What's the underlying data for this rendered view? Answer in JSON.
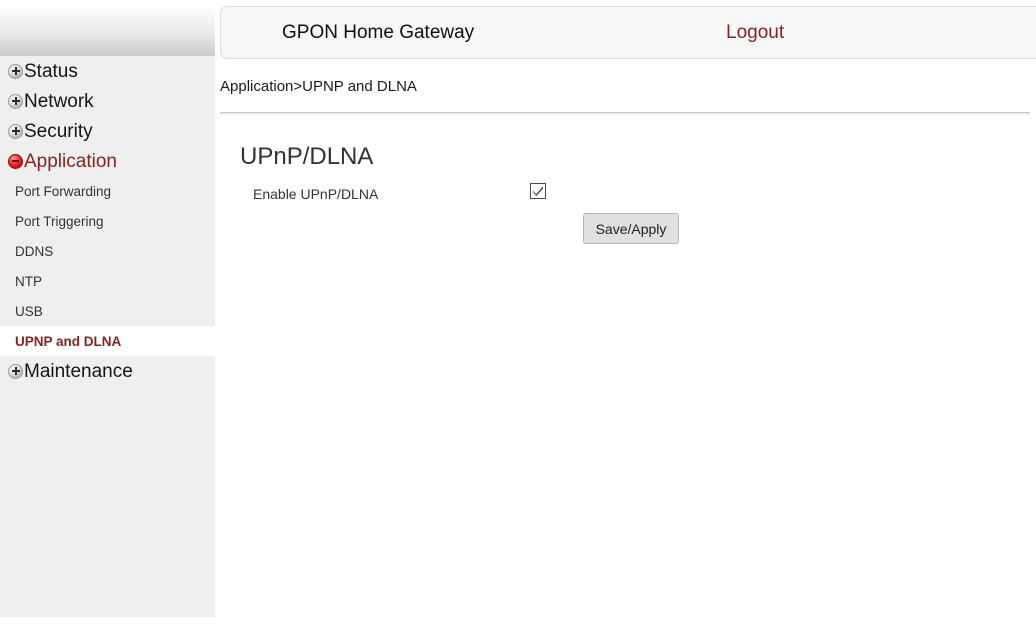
{
  "header": {
    "title": "GPON Home Gateway",
    "logout_label": "Logout"
  },
  "breadcrumb": {
    "text": "Application>UPNP and DLNA"
  },
  "sidebar": {
    "top_items": [
      {
        "label": "Status",
        "icon": "plus-icon",
        "expanded": false,
        "active": false
      },
      {
        "label": "Network",
        "icon": "plus-icon",
        "expanded": false,
        "active": false
      },
      {
        "label": "Security",
        "icon": "plus-icon",
        "expanded": false,
        "active": false
      },
      {
        "label": "Application",
        "icon": "minus-icon",
        "expanded": true,
        "active": true
      }
    ],
    "sub_items": [
      {
        "label": "Port Forwarding",
        "active": false
      },
      {
        "label": "Port Triggering",
        "active": false
      },
      {
        "label": "DDNS",
        "active": false
      },
      {
        "label": "NTP",
        "active": false
      },
      {
        "label": "USB",
        "active": false
      },
      {
        "label": "UPNP and DLNA",
        "active": true
      }
    ],
    "last_item": {
      "label": "Maintenance",
      "icon": "plus-icon",
      "expanded": false,
      "active": false
    }
  },
  "main": {
    "page_title": "UPnP/DLNA",
    "enable_label": "Enable UPnP/DLNA",
    "enable_checked": true,
    "save_label": "Save/Apply"
  },
  "colors": {
    "accent_red": "#8a1f1f",
    "sidebar_bg": "#efefef",
    "header_bg": "#f7f7f7",
    "button_bg": "#e0e0e0"
  }
}
